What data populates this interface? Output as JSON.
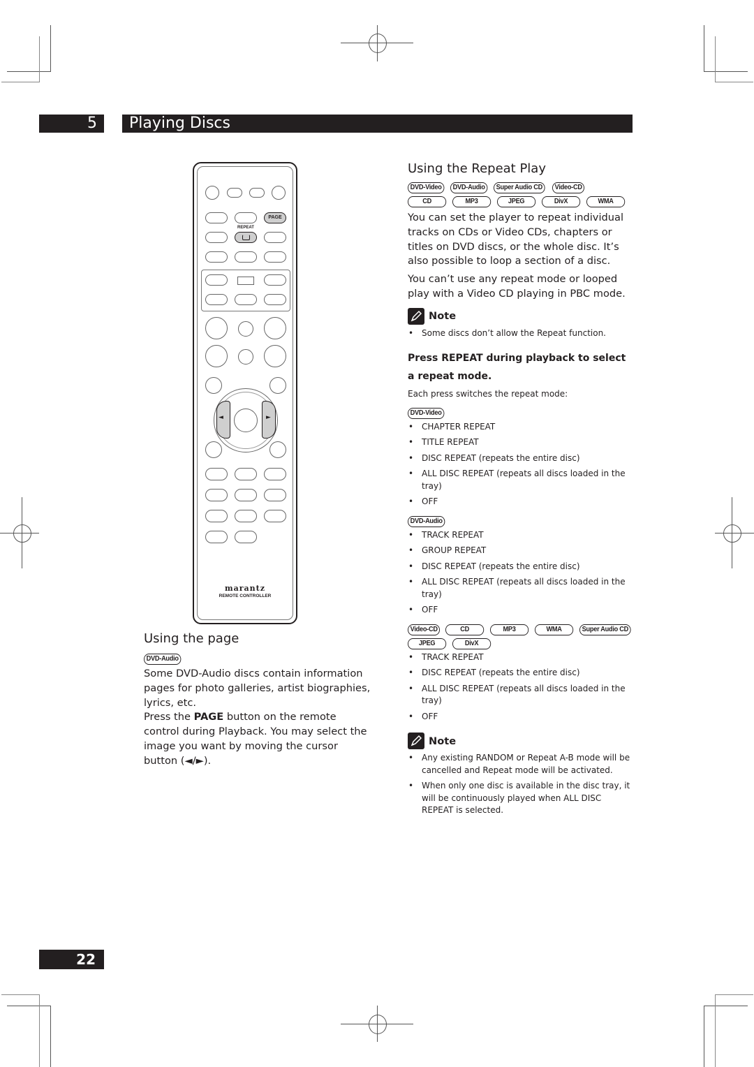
{
  "header": {
    "chapter_number": "5",
    "chapter_title": "Playing Discs"
  },
  "footer": {
    "page_number": "22"
  },
  "remote": {
    "page_label": "PAGE",
    "repeat_label": "REPEAT",
    "repeat_icon": "repeat-icon",
    "left_arrow": "◄",
    "right_arrow": "►",
    "brand": "marantz",
    "brand_sub": "REMOTE CONTROLLER"
  },
  "using_page": {
    "title": "Using the page",
    "badges": [
      "DVD-Audio"
    ],
    "paragraph1": "Some DVD-Audio discs contain information pages for photo galleries, artist biographies, lyrics, etc.",
    "paragraph2_pre": "Press the ",
    "paragraph2_bold": "PAGE",
    "paragraph2_post": " button on the remote control during Playback. You may select the image you want by moving the cursor button (◄/►)."
  },
  "repeat_play": {
    "title": "Using the Repeat Play",
    "badges_row1": [
      "DVD-Video",
      "DVD-Audio",
      "Super Audio CD",
      "Video-CD"
    ],
    "badges_row2": [
      "CD",
      "MP3",
      "JPEG",
      "DivX",
      "WMA"
    ],
    "paragraph1": "You can set the player to repeat individual tracks on CDs or Video CDs, chapters or titles on DVD discs, or the whole disc. It’s also possible to loop a section of a disc.",
    "paragraph2": "You can’t use any repeat mode or looped play with a Video CD playing in PBC mode.",
    "note1": {
      "label": "Note",
      "items": [
        "Some discs don’t allow the Repeat function."
      ]
    },
    "step_heading": "Press REPEAT during playback to select a repeat mode.",
    "step_intro": "Each press switches the repeat mode:",
    "groups": [
      {
        "badges": [
          "DVD-Video"
        ],
        "items": [
          "CHAPTER REPEAT",
          "TITLE REPEAT",
          "DISC REPEAT (repeats the entire disc)",
          "ALL DISC REPEAT (repeats all discs loaded in the tray)",
          "OFF"
        ]
      },
      {
        "badges": [
          "DVD-Audio"
        ],
        "items": [
          "TRACK REPEAT",
          "GROUP REPEAT",
          "DISC REPEAT (repeats the entire disc)",
          "ALL DISC REPEAT (repeats all discs loaded in the tray)",
          "OFF"
        ]
      },
      {
        "badges_row1": [
          "Video-CD",
          "CD",
          "MP3",
          "WMA",
          "Super Audio CD"
        ],
        "badges_row2": [
          "JPEG",
          "DivX"
        ],
        "items": [
          "TRACK REPEAT",
          "DISC REPEAT (repeats the entire disc)",
          "ALL DISC REPEAT (repeats all discs loaded in the tray)",
          "OFF"
        ]
      }
    ],
    "note2": {
      "label": "Note",
      "items": [
        "Any existing RANDOM or Repeat A-B mode will be cancelled and Repeat mode will be activated.",
        "When only one disc is available in the disc tray, it will be continuously played when ALL DISC REPEAT is selected."
      ]
    }
  }
}
